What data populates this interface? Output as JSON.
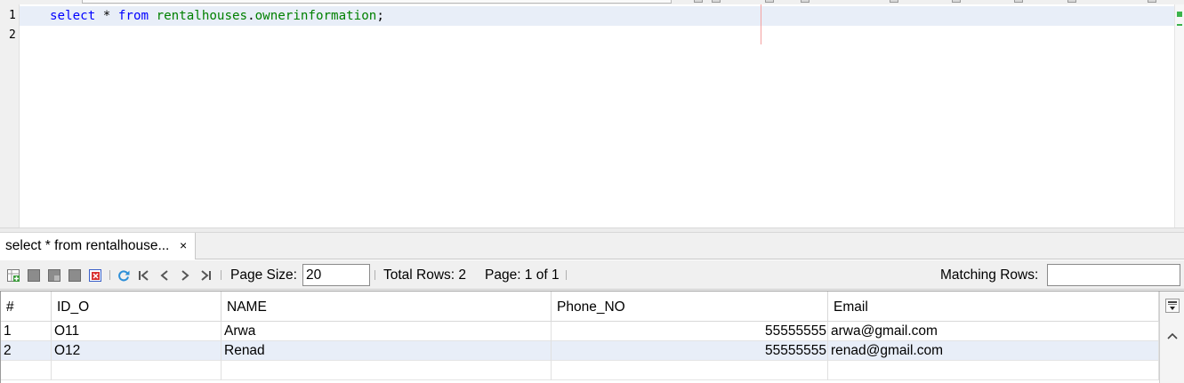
{
  "editor": {
    "lines": [
      {
        "number": "1",
        "tokens": [
          {
            "text": "select",
            "kind": "keyword"
          },
          {
            "text": " * ",
            "kind": "plain"
          },
          {
            "text": "from",
            "kind": "keyword"
          },
          {
            "text": " ",
            "kind": "plain"
          },
          {
            "text": "rentalhouses",
            "kind": "identifier"
          },
          {
            "text": ".",
            "kind": "plain"
          },
          {
            "text": "ownerinformation",
            "kind": "identifier"
          },
          {
            "text": ";",
            "kind": "plain"
          }
        ]
      },
      {
        "number": "2",
        "tokens": []
      }
    ],
    "colors": {
      "keyword": "#0000ff",
      "identifier": "#008000",
      "current_line": "#e8eef8"
    }
  },
  "results_tab": {
    "label": "select * from rentalhouse...",
    "close": "×"
  },
  "toolbar": {
    "icons": [
      "insert-row-icon",
      "save-grid-icon",
      "duplicate-row-icon",
      "grid-icon",
      "delete-row-icon",
      "refresh-icon",
      "first-page-icon",
      "previous-page-icon",
      "next-page-icon",
      "last-page-icon"
    ],
    "page_size_label": "Page Size:",
    "page_size_value": "20",
    "total_rows_label": "Total Rows: 2",
    "page_label": "Page: 1 of 1",
    "matching_rows_label": "Matching Rows:",
    "matching_rows_value": ""
  },
  "grid": {
    "columns": [
      "#",
      "ID_O",
      "NAME",
      "Phone_NO",
      "Email"
    ],
    "rows": [
      [
        "1",
        "O11",
        "Arwa",
        "55555555",
        "arwa@gmail.com"
      ],
      [
        "2",
        "O12",
        "Renad",
        "55555555",
        "renad@gmail.com"
      ]
    ],
    "selected_row": 1
  }
}
